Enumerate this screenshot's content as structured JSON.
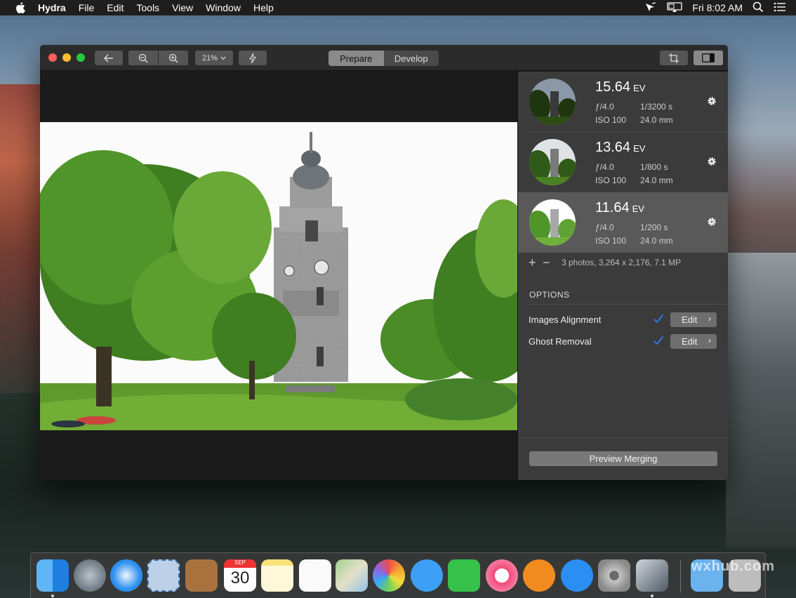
{
  "menubar": {
    "app_name": "Hydra",
    "items": [
      "File",
      "Edit",
      "Tools",
      "View",
      "Window",
      "Help"
    ],
    "clock": "Fri 8:02 AM"
  },
  "toolbar": {
    "zoom_value": "21%",
    "tabs": [
      {
        "label": "Prepare",
        "active": true
      },
      {
        "label": "Develop",
        "active": false
      }
    ]
  },
  "panel": {
    "shots": [
      {
        "ev": "15.64",
        "ev_unit": "EV",
        "aperture": "ƒ/4.0",
        "shutter": "1/3200 s",
        "iso": "ISO 100",
        "focal": "24.0 mm",
        "selected": false
      },
      {
        "ev": "13.64",
        "ev_unit": "EV",
        "aperture": "ƒ/4.0",
        "shutter": "1/800 s",
        "iso": "ISO 100",
        "focal": "24.0 mm",
        "selected": false
      },
      {
        "ev": "11.64",
        "ev_unit": "EV",
        "aperture": "ƒ/4.0",
        "shutter": "1/200 s",
        "iso": "ISO 100",
        "focal": "24.0 mm",
        "selected": true
      }
    ],
    "add_label": "+",
    "remove_label": "−",
    "summary": "3 photos, 3,264 x 2,176, 7.1 MP",
    "options_heading": "OPTIONS",
    "options": [
      {
        "label": "Images Alignment",
        "checked": true,
        "button": "Edit"
      },
      {
        "label": "Ghost Removal",
        "checked": true,
        "button": "Edit"
      }
    ],
    "preview_button": "Preview Merging"
  },
  "dock": {
    "apps": [
      "finder-icon",
      "launchpad-icon",
      "safari-icon",
      "mail-icon",
      "contacts-icon",
      "calendar-icon",
      "notes-icon",
      "reminders-icon",
      "maps-icon",
      "photos-icon",
      "messages-icon",
      "facetime-icon",
      "itunes-icon",
      "ibooks-icon",
      "app-store-icon",
      "system-preferences-icon",
      "hydra-icon"
    ],
    "calendar_month": "SEP",
    "calendar_day": "30",
    "watermark": "wxhub.com"
  },
  "colors": {
    "accent_check": "#2f7bf5",
    "close": "#fe5f57",
    "minimize": "#febc2e",
    "zoom": "#28c840"
  }
}
